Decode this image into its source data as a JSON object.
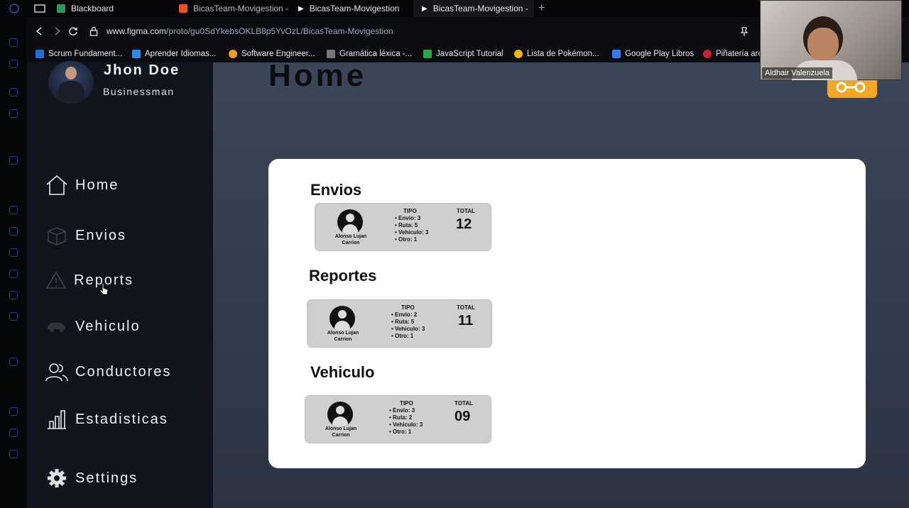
{
  "browser": {
    "tabs": [
      {
        "label": "Blackboard"
      },
      {
        "label": "BicasTeam-Movigestion -"
      },
      {
        "label": "BicasTeam-Movigestion"
      },
      {
        "label": "BicasTeam-Movigestion -"
      }
    ],
    "new_tab": "+",
    "url_host": "www.figma.com",
    "url_path": "/proto/gu0SdYkebsOKLB8p5YvOzL/BicasTeam-Movigestion",
    "bookmarks": [
      {
        "label": "Scrum Fundament...",
        "color": "#1f6fd6"
      },
      {
        "label": "Aprender Idiomas...",
        "color": "#2a8cf0"
      },
      {
        "label": "Software Engineer...",
        "color": "#f0a020"
      },
      {
        "label": "Gramática léxica -...",
        "color": "#cccccc"
      },
      {
        "label": "JavaScript Tutorial",
        "color": "#27a845"
      },
      {
        "label": "Lista de Pokémon...",
        "color": "#f0b400"
      },
      {
        "label": "Google Play Libros",
        "color": "#2f7df0"
      },
      {
        "label": "Piñatería arc",
        "color": "#d02030"
      }
    ]
  },
  "profile": {
    "name": "Jhon Doe",
    "role": "Businessman"
  },
  "nav": [
    {
      "label": "Home",
      "icon": "home-icon"
    },
    {
      "label": "Envios",
      "icon": "box-icon"
    },
    {
      "label": "Reports",
      "icon": "warning-icon"
    },
    {
      "label": "Vehiculo",
      "icon": "car-icon"
    },
    {
      "label": "Conductores",
      "icon": "users-icon"
    },
    {
      "label": "Estadisticas",
      "icon": "bar-chart-icon"
    },
    {
      "label": "Settings",
      "icon": "gear-icon"
    }
  ],
  "page": {
    "title": "Home"
  },
  "sections": [
    {
      "title": "Envios",
      "person": "Alonso Lujan Carrion",
      "tipo_label": "TIPO",
      "items": [
        "Envio: 3",
        "Ruta: 5",
        "Vehiculo: 3",
        "Otro: 1"
      ],
      "total_label": "TOTAL",
      "total": "12"
    },
    {
      "title": "Reportes",
      "person": "Alonso Lujan Carrion",
      "tipo_label": "TIPO",
      "items": [
        "Envio: 2",
        "Ruta: 5",
        "Vehiculo: 3",
        "Otro: 1"
      ],
      "total_label": "TOTAL",
      "total": "11"
    },
    {
      "title": "Vehiculo",
      "person": "Alonso Lujan Carrion",
      "tipo_label": "TIPO",
      "items": [
        "Envio: 3",
        "Ruta: 2",
        "Vehiculo: 3",
        "Otro: 1"
      ],
      "total_label": "TOTAL",
      "total": "09"
    }
  ],
  "webcam": {
    "name": "Aldhair Valenzuela"
  },
  "colors": {
    "sidebar": "#11141d",
    "content": "#3b4658",
    "accent": "#f5a623"
  }
}
